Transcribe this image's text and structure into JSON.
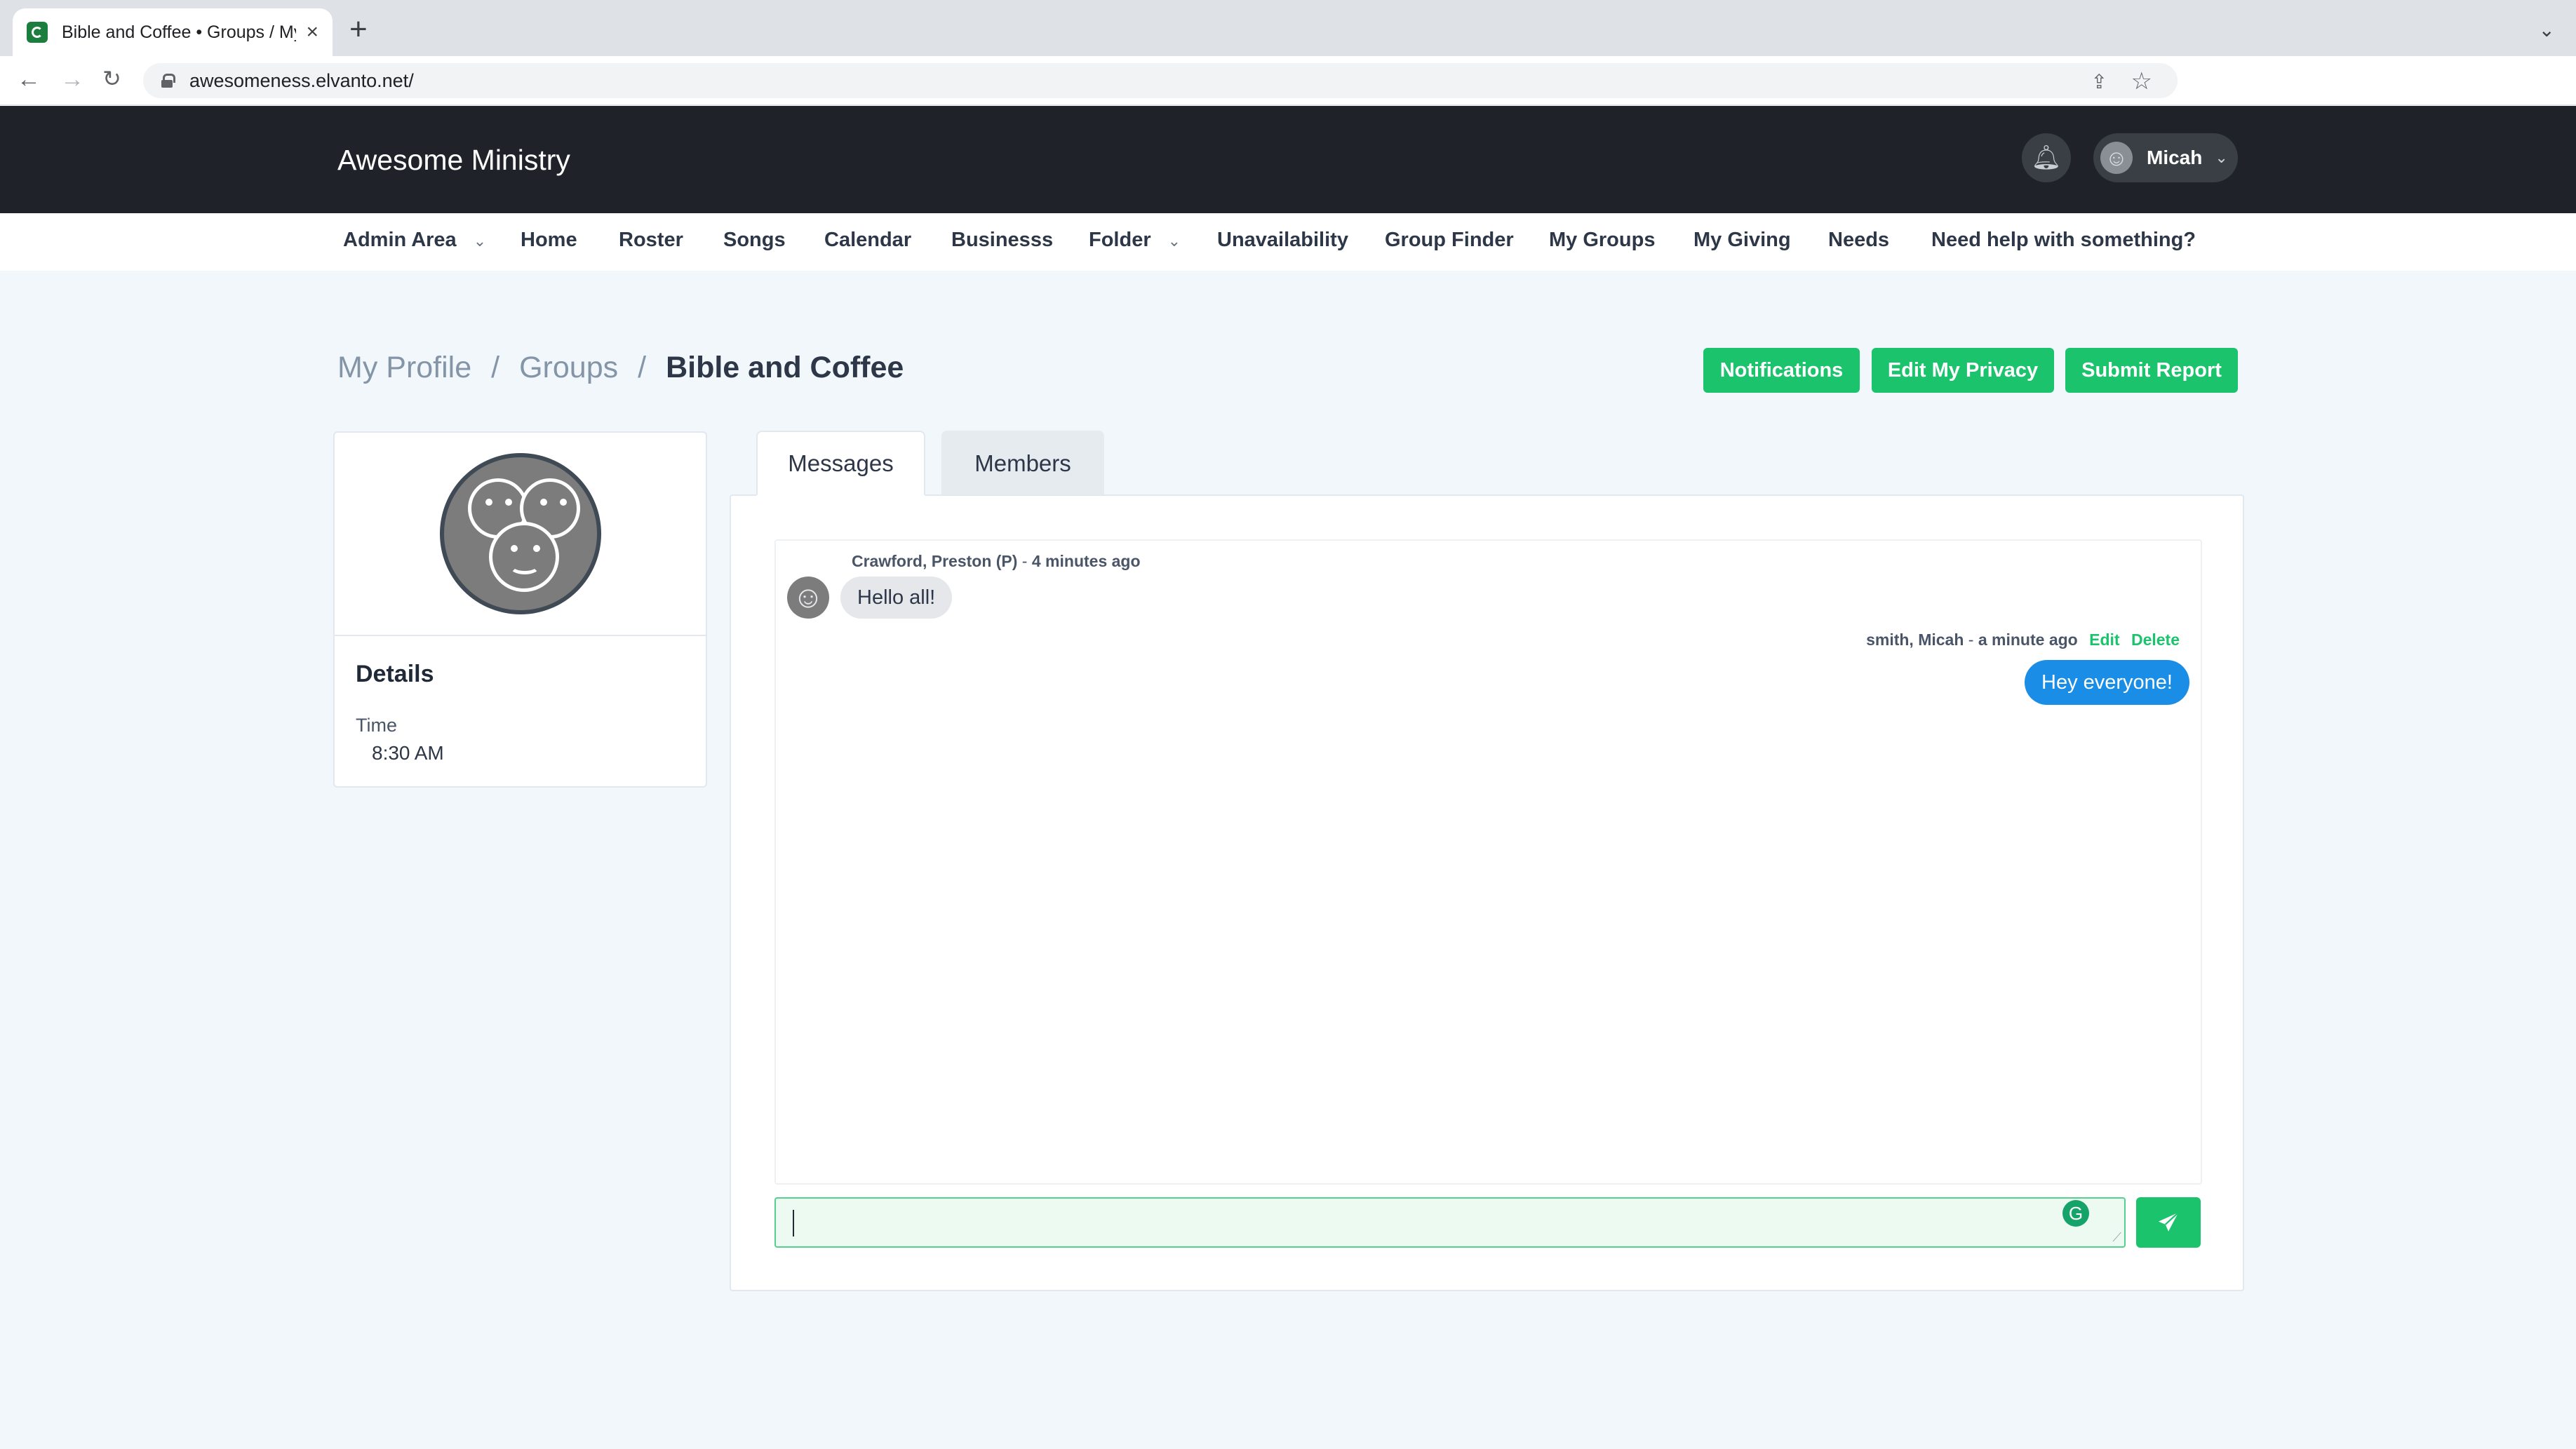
{
  "browser": {
    "tab_title": "Bible and Coffee • Groups / My",
    "tab_close": "×",
    "new_tab": "+",
    "url": "awesomeness.elvanto.net/"
  },
  "app": {
    "brand": "Awesome Ministry",
    "user_name": "Micah"
  },
  "nav": {
    "items": [
      {
        "label": "Admin Area",
        "has_dropdown": true
      },
      {
        "label": "Home"
      },
      {
        "label": "Roster"
      },
      {
        "label": "Songs"
      },
      {
        "label": "Calendar"
      },
      {
        "label": "Businesss"
      },
      {
        "label": "Folder",
        "has_dropdown": true
      },
      {
        "label": "Unavailability"
      },
      {
        "label": "Group Finder"
      },
      {
        "label": "My Groups"
      },
      {
        "label": "My Giving"
      },
      {
        "label": "Needs"
      },
      {
        "label": "Need help with something?"
      }
    ]
  },
  "breadcrumb": {
    "items": [
      "My Profile",
      "Groups",
      "Bible and Coffee"
    ],
    "separator": "/"
  },
  "actions": {
    "notifications": "Notifications",
    "edit_privacy": "Edit My Privacy",
    "submit_report": "Submit Report"
  },
  "profile_card": {
    "details_title": "Details",
    "time_label": "Time",
    "time_value": "8:30 AM"
  },
  "tabs": {
    "messages": "Messages",
    "members": "Members",
    "active": "Messages"
  },
  "messages": [
    {
      "author": "Crawford, Preston (P)",
      "age": "4 minutes ago",
      "text": "Hello all!",
      "own": false
    },
    {
      "author": "smith, Micah",
      "age": "a minute ago",
      "text": "Hey everyone!",
      "own": true,
      "edit_label": "Edit",
      "delete_label": "Delete"
    }
  ],
  "composer": {
    "value": "",
    "send_icon": "paper-plane-icon"
  },
  "colors": {
    "header_bg": "#1f2329",
    "accent_green": "#1bc36c",
    "bubble_blue": "#1a8ee6",
    "page_bg": "#f2f7fb"
  }
}
